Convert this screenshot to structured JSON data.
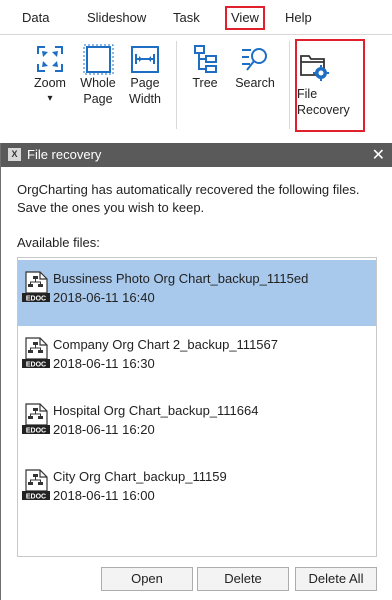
{
  "menu": {
    "items": [
      "Data",
      "Slideshow",
      "Task",
      "View",
      "Help"
    ],
    "active_index": 3
  },
  "ribbon": {
    "zoom": {
      "label": "Zoom",
      "arrow": "▾",
      "icon": "zoom-fit-icon"
    },
    "whole_page": {
      "line1": "Whole",
      "line2": "Page",
      "icon": "whole-page-icon"
    },
    "page_width": {
      "line1": "Page",
      "line2": "Width",
      "icon": "page-width-icon"
    },
    "tree": {
      "label": "Tree",
      "icon": "tree-icon"
    },
    "search": {
      "label": "Search",
      "icon": "search-icon"
    },
    "file_recovery": {
      "line1": "File",
      "line2": "Recovery",
      "icon": "file-recovery-icon"
    }
  },
  "dialog": {
    "title": "File recovery",
    "close": "✕",
    "message": "OrgCharting has automatically recovered the following files. Save the ones you wish to keep.",
    "available_label": "Available files:",
    "icon_badge": "EDOC",
    "files": [
      {
        "name": "Bussiness Photo Org Chart_backup_1115ed",
        "date": "2018-06-11 16:40",
        "selected": true
      },
      {
        "name": "Company Org Chart 2_backup_111567",
        "date": "2018-06-11 16:30",
        "selected": false
      },
      {
        "name": "Hospital Org Chart_backup_111664",
        "date": "2018-06-11 16:20",
        "selected": false
      },
      {
        "name": "City Org Chart_backup_11159",
        "date": "2018-06-11 16:00",
        "selected": false
      }
    ],
    "buttons": {
      "open": "Open",
      "delete": "Delete",
      "delete_all": "Delete All"
    }
  },
  "colors": {
    "highlight": "#e0202a",
    "selection": "#a9c9ec",
    "titlebar": "#5a5a5a",
    "icon_blue": "#1e6fc4"
  }
}
